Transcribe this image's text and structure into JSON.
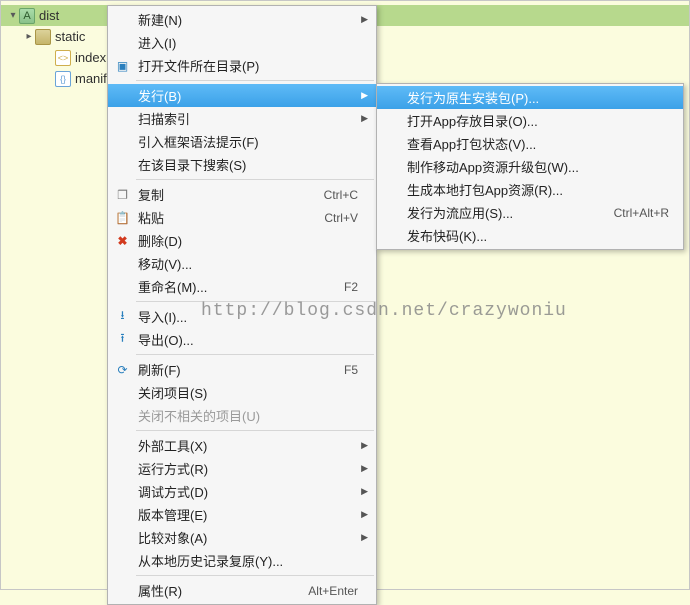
{
  "tree": {
    "root": {
      "label": "dist"
    },
    "static": {
      "label": "static"
    },
    "index": {
      "label": "index.ht"
    },
    "manifest": {
      "label": "manifes"
    }
  },
  "menu": {
    "new": {
      "label": "新建(N)"
    },
    "into": {
      "label": "进入(I)"
    },
    "openloc": {
      "label": "打开文件所在目录(P)"
    },
    "publish": {
      "label": "发行(B)"
    },
    "scan": {
      "label": "扫描索引"
    },
    "hint": {
      "label": "引入框架语法提示(F)"
    },
    "search": {
      "label": "在该目录下搜索(S)"
    },
    "copy": {
      "label": "复制",
      "shortcut": "Ctrl+C"
    },
    "paste": {
      "label": "粘贴",
      "shortcut": "Ctrl+V"
    },
    "delete": {
      "label": "删除(D)"
    },
    "move": {
      "label": "移动(V)..."
    },
    "rename": {
      "label": "重命名(M)...",
      "shortcut": "F2"
    },
    "import": {
      "label": "导入(I)..."
    },
    "export": {
      "label": "导出(O)..."
    },
    "refresh": {
      "label": "刷新(F)",
      "shortcut": "F5"
    },
    "closeproj": {
      "label": "关闭项目(S)"
    },
    "closeunrel": {
      "label": "关闭不相关的项目(U)"
    },
    "exttool": {
      "label": "外部工具(X)"
    },
    "runmode": {
      "label": "运行方式(R)"
    },
    "dbgmode": {
      "label": "调试方式(D)"
    },
    "vermgr": {
      "label": "版本管理(E)"
    },
    "compare": {
      "label": "比较对象(A)"
    },
    "restore": {
      "label": "从本地历史记录复原(Y)..."
    },
    "props": {
      "label": "属性(R)",
      "shortcut": "Alt+Enter"
    }
  },
  "submenu": {
    "native": {
      "label": "发行为原生安装包(P)..."
    },
    "openwgt": {
      "label": "打开App存放目录(O)..."
    },
    "status": {
      "label": "查看App打包状态(V)..."
    },
    "upgrade": {
      "label": "制作移动App资源升级包(W)..."
    },
    "localres": {
      "label": "生成本地打包App资源(R)..."
    },
    "stream": {
      "label": "发行为流应用(S)...",
      "shortcut": "Ctrl+Alt+R"
    },
    "qrcode": {
      "label": "发布快码(K)..."
    }
  },
  "watermark": "http://blog.csdn.net/crazywoniu"
}
